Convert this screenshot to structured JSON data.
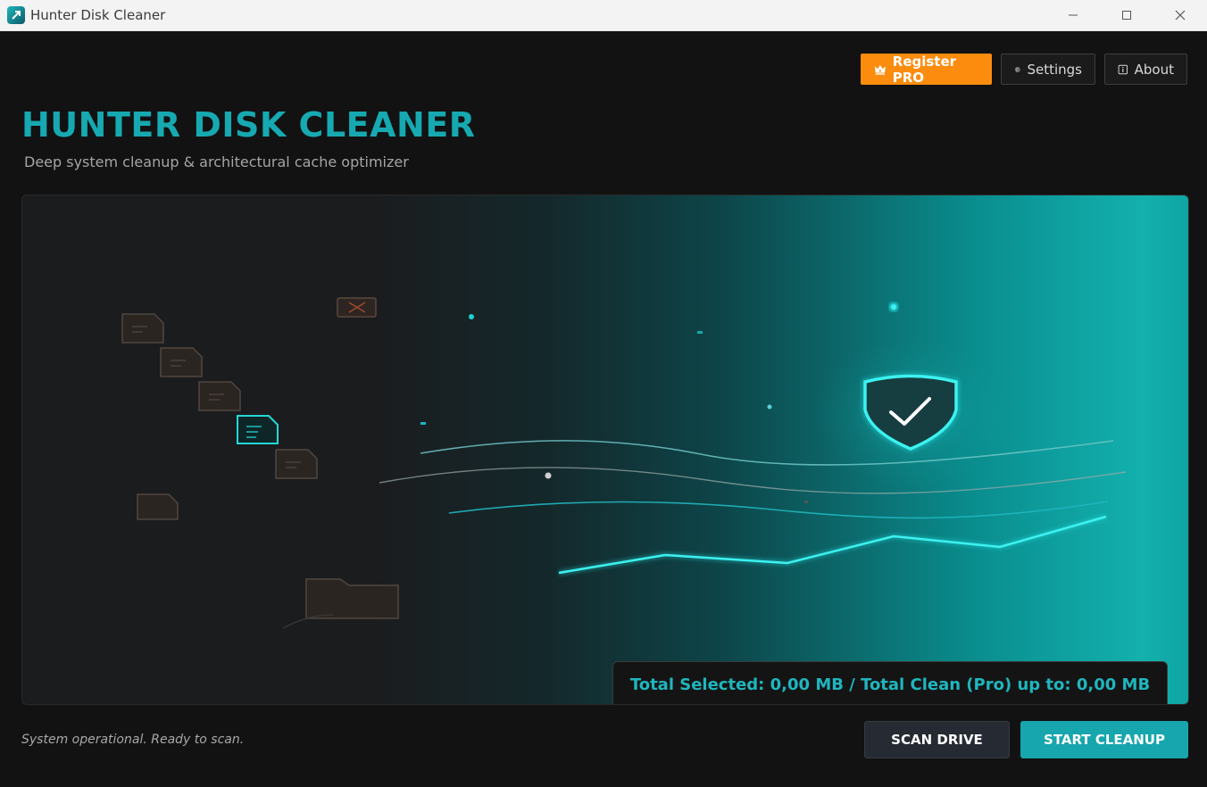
{
  "window": {
    "title": "Hunter Disk Cleaner",
    "icon": "app-logo-icon",
    "controls": [
      "minimize-icon",
      "maximize-icon",
      "close-icon"
    ]
  },
  "toolbar": {
    "register_label": "Register PRO",
    "register_icon": "crown-icon",
    "settings_label": "Settings",
    "settings_icon": "gear-icon",
    "about_label": "About",
    "about_icon": "info-icon"
  },
  "header": {
    "title": "HUNTER DISK CLEANER",
    "subtitle": "Deep system cleanup & architectural cache optimizer"
  },
  "hero": {
    "illustration_icons": [
      "file-icon",
      "folder-icon",
      "broken-file-icon",
      "shield-check-icon"
    ],
    "total_text": "Total Selected: 0,00 MB / Total Clean (Pro) up to: 0,00 MB"
  },
  "footer": {
    "status": "System operational. Ready to scan.",
    "scan_label": "SCAN DRIVE",
    "cleanup_label": "START CLEANUP"
  },
  "colors": {
    "accent": "#17a9b1",
    "pro": "#fb8c0e",
    "background": "#121212",
    "glow": "#25e5e5"
  }
}
